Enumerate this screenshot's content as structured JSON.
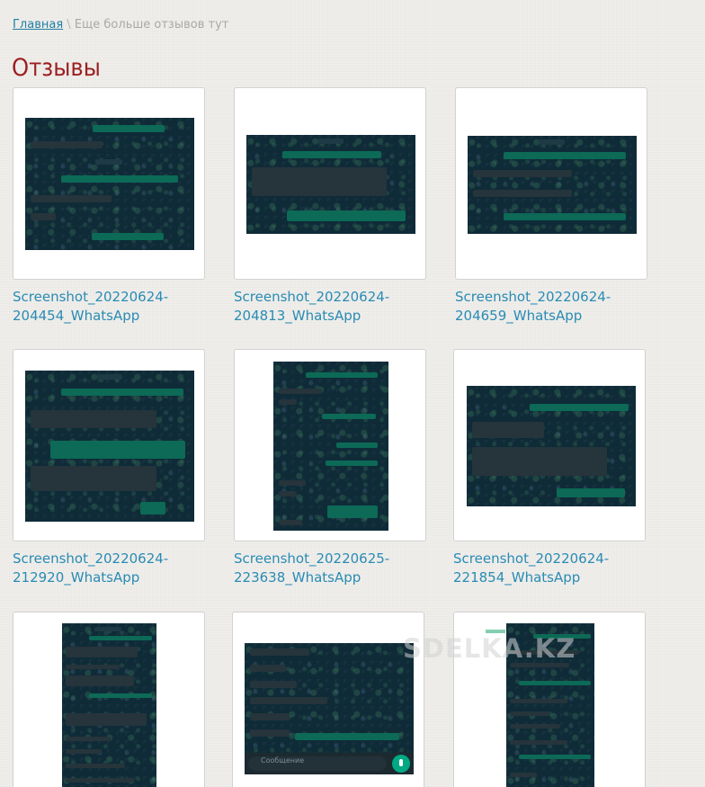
{
  "breadcrumb": {
    "home": "Главная",
    "separator": "\\",
    "current": "Еще больше отзывов тут"
  },
  "title": "Отзывы",
  "gallery": [
    {
      "caption_line1": "Screenshot_20220624-",
      "caption_line2": "204454_WhatsApp"
    },
    {
      "caption_line1": "Screenshot_20220624-",
      "caption_line2": "204813_WhatsApp"
    },
    {
      "caption_line1": "Screenshot_20220624-",
      "caption_line2": "204659_WhatsApp"
    },
    {
      "caption_line1": "Screenshot_20220624-",
      "caption_line2": "212920_WhatsApp"
    },
    {
      "caption_line1": "Screenshot_20220625-",
      "caption_line2": "223638_WhatsApp"
    },
    {
      "caption_line1": "Screenshot_20220624-",
      "caption_line2": "221854_WhatsApp"
    },
    {},
    {
      "input_placeholder": "Сообщение"
    },
    {}
  ],
  "watermark": "SDELKA.KZ",
  "colors": {
    "title": "#9c1f1f",
    "link": "#2a8bb3",
    "chat_background": "#0f2b38",
    "outgoing_bubble": "#0c6a56",
    "incoming_bubble": "#26343b"
  }
}
